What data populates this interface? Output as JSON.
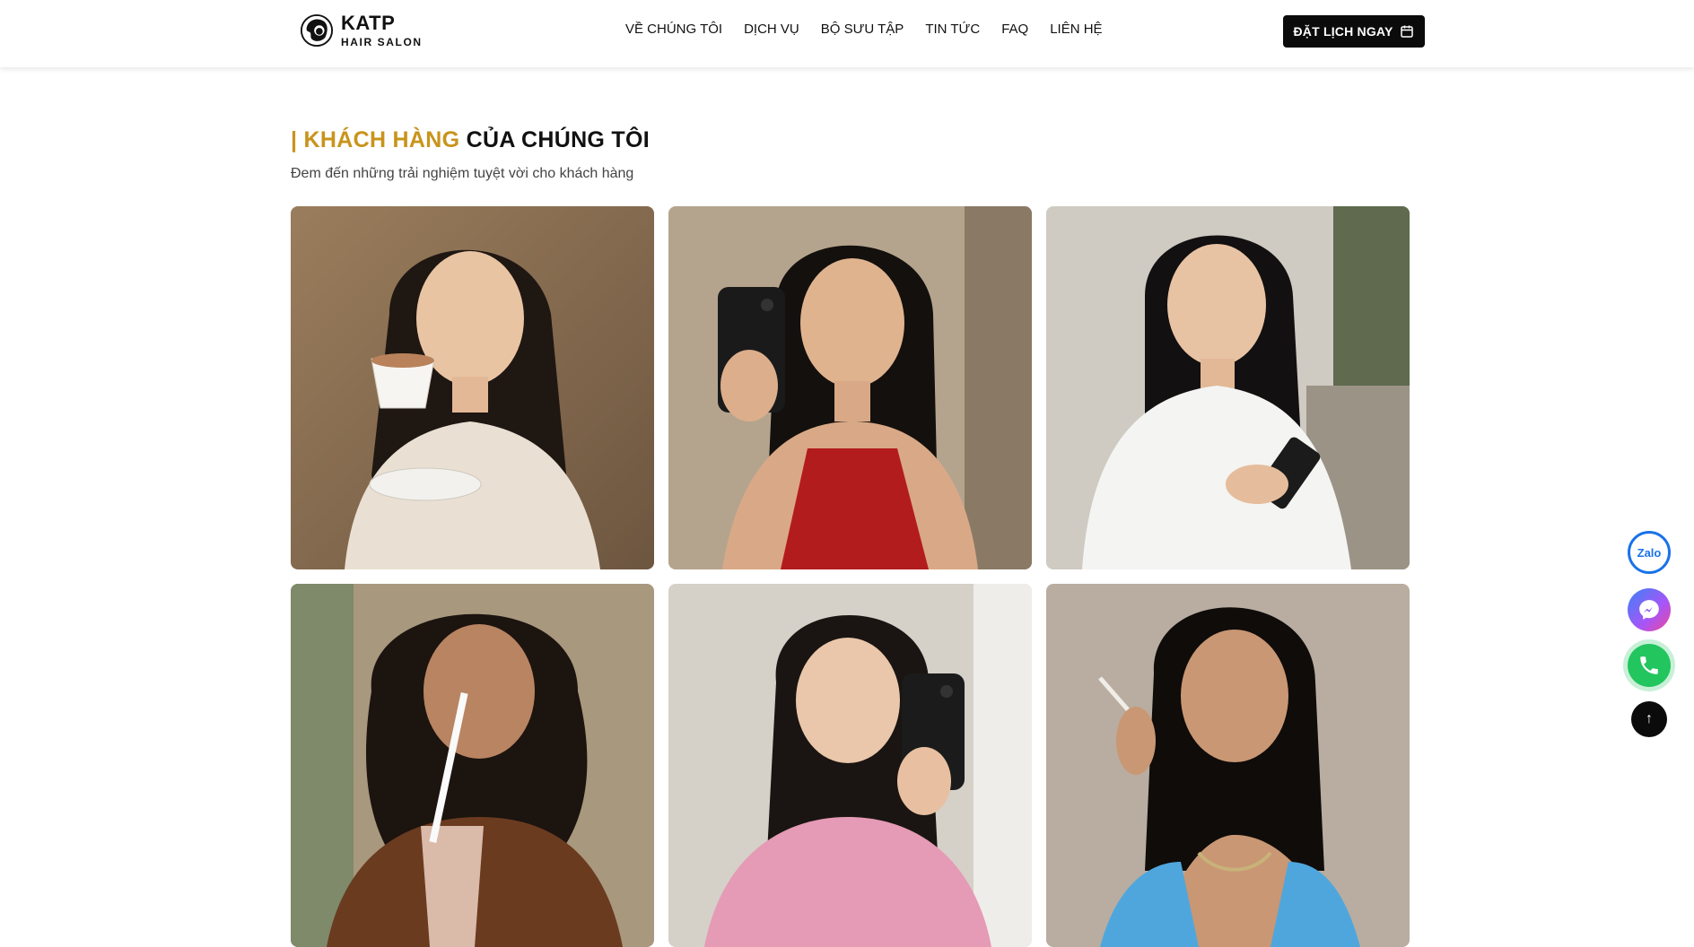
{
  "brand": {
    "name": "KATP",
    "tagline": "HAIR SALON"
  },
  "nav": [
    {
      "label": "VỀ CHÚNG TÔI"
    },
    {
      "label": "DỊCH VỤ"
    },
    {
      "label": "BỘ SƯU TẬP"
    },
    {
      "label": "TIN TỨC"
    },
    {
      "label": "FAQ"
    },
    {
      "label": "LIÊN HỆ"
    }
  ],
  "cta": {
    "label": "ĐẶT LỊCH NGAY",
    "icon": "calendar-icon"
  },
  "section": {
    "title_accent": "| KHÁCH HÀNG",
    "title_rest": " CỦA CHÚNG TÔI",
    "subtitle": "Đem đến những trải nghiệm tuyệt vời cho khách hàng"
  },
  "gallery": [
    {
      "name": "customer-photo-1"
    },
    {
      "name": "customer-photo-2"
    },
    {
      "name": "customer-photo-3"
    },
    {
      "name": "customer-photo-4"
    },
    {
      "name": "customer-photo-5"
    },
    {
      "name": "customer-photo-6"
    }
  ],
  "floating": {
    "zalo_label": "Zalo",
    "messenger_icon": "messenger-icon",
    "phone_icon": "phone-icon",
    "top_label": "↑"
  },
  "colors": {
    "accent": "#c8941b",
    "dark": "#0b0b0b",
    "zalo": "#1a73e8",
    "phone": "#22c55e"
  }
}
